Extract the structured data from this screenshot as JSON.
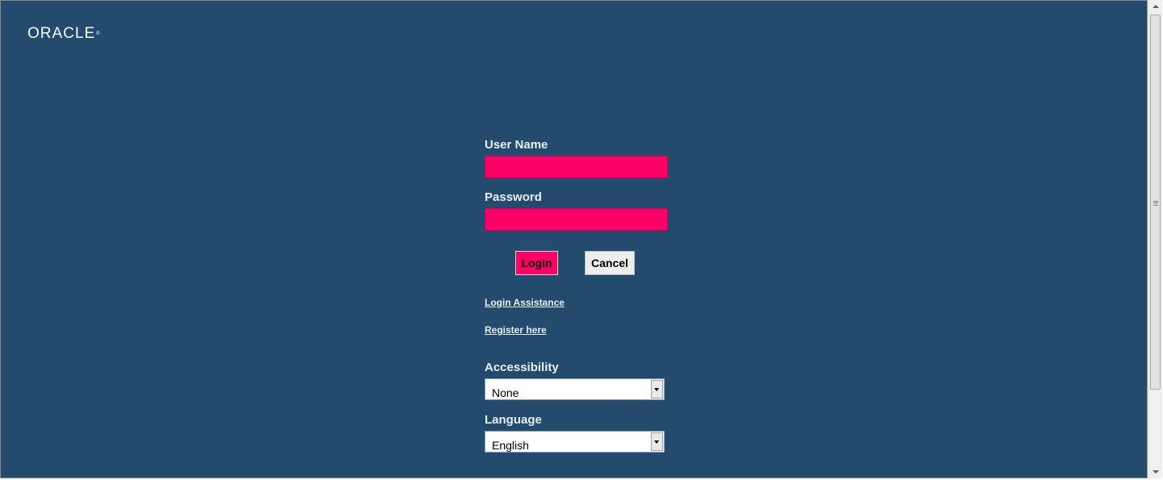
{
  "header": {
    "logo_text": "ORACLE",
    "logo_mark": "®"
  },
  "login_form": {
    "username_label": "User Name",
    "username_value": "",
    "password_label": "Password",
    "password_value": "",
    "login_button": "Login",
    "cancel_button": "Cancel",
    "login_assistance_link": "Login Assistance",
    "register_link": "Register here",
    "accessibility_label": "Accessibility",
    "accessibility_value": "None",
    "language_label": "Language",
    "language_value": "English"
  },
  "colors": {
    "page_background": "#224b6e",
    "required_field": "#ff0066",
    "label_text": "#e8eef3"
  },
  "icons": {
    "select_arrow": "chevron-down-icon",
    "scroll_up": "arrow-up-icon",
    "scroll_down": "arrow-down-icon"
  }
}
